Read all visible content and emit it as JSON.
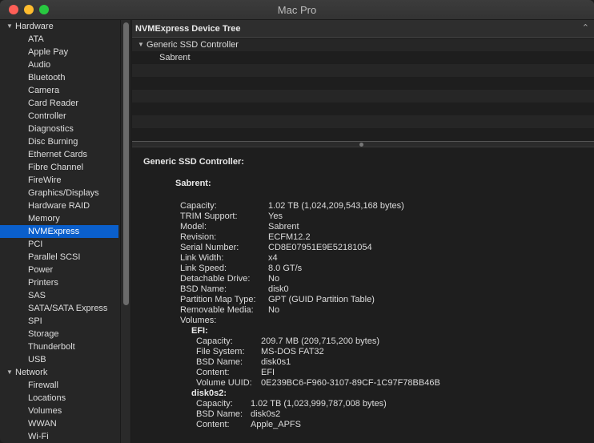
{
  "window": {
    "title": "Mac Pro"
  },
  "sidebar": {
    "items": [
      {
        "label": "Hardware",
        "group": true
      },
      {
        "label": "ATA"
      },
      {
        "label": "Apple Pay"
      },
      {
        "label": "Audio"
      },
      {
        "label": "Bluetooth"
      },
      {
        "label": "Camera"
      },
      {
        "label": "Card Reader"
      },
      {
        "label": "Controller"
      },
      {
        "label": "Diagnostics"
      },
      {
        "label": "Disc Burning"
      },
      {
        "label": "Ethernet Cards"
      },
      {
        "label": "Fibre Channel"
      },
      {
        "label": "FireWire"
      },
      {
        "label": "Graphics/Displays"
      },
      {
        "label": "Hardware RAID"
      },
      {
        "label": "Memory"
      },
      {
        "label": "NVMExpress",
        "selected": true
      },
      {
        "label": "PCI"
      },
      {
        "label": "Parallel SCSI"
      },
      {
        "label": "Power"
      },
      {
        "label": "Printers"
      },
      {
        "label": "SAS"
      },
      {
        "label": "SATA/SATA Express"
      },
      {
        "label": "SPI"
      },
      {
        "label": "Storage"
      },
      {
        "label": "Thunderbolt"
      },
      {
        "label": "USB"
      },
      {
        "label": "Network",
        "group": true
      },
      {
        "label": "Firewall"
      },
      {
        "label": "Locations"
      },
      {
        "label": "Volumes"
      },
      {
        "label": "WWAN"
      },
      {
        "label": "Wi-Fi"
      }
    ]
  },
  "tree": {
    "header": "NVMExpress Device Tree",
    "rows": [
      {
        "label": "Generic SSD Controller",
        "expanded": true
      },
      {
        "label": "Sabrent"
      }
    ]
  },
  "detail": {
    "controller_title": "Generic SSD Controller:",
    "device_title": "Sabrent:",
    "properties": [
      {
        "key": "Capacity:",
        "value": "1.02 TB (1,024,209,543,168 bytes)"
      },
      {
        "key": "TRIM Support:",
        "value": "Yes"
      },
      {
        "key": "Model:",
        "value": "Sabrent"
      },
      {
        "key": "Revision:",
        "value": "ECFM12.2"
      },
      {
        "key": "Serial Number:",
        "value": "CD8E07951E9E52181054"
      },
      {
        "key": "Link Width:",
        "value": "x4"
      },
      {
        "key": "Link Speed:",
        "value": "8.0 GT/s"
      },
      {
        "key": "Detachable Drive:",
        "value": "No"
      },
      {
        "key": "BSD Name:",
        "value": "disk0"
      },
      {
        "key": "Partition Map Type:",
        "value": "GPT (GUID Partition Table)"
      },
      {
        "key": "Removable Media:",
        "value": "No"
      }
    ],
    "volumes_label": "Volumes:",
    "volumes": [
      {
        "name": "EFI:",
        "properties": [
          {
            "key": "Capacity:",
            "value": "209.7 MB (209,715,200 bytes)"
          },
          {
            "key": "File System:",
            "value": "MS-DOS FAT32"
          },
          {
            "key": "BSD Name:",
            "value": "disk0s1"
          },
          {
            "key": "Content:",
            "value": "EFI"
          },
          {
            "key": "Volume UUID:",
            "value": "0E239BC6-F960-3107-89CF-1C97F78BB46B"
          }
        ]
      },
      {
        "name": "disk0s2:",
        "properties": [
          {
            "key": "Capacity:",
            "value": "1.02 TB (1,023,999,787,008 bytes)"
          },
          {
            "key": "BSD Name:",
            "value": "disk0s2"
          },
          {
            "key": "Content:",
            "value": "Apple_APFS"
          }
        ]
      }
    ]
  }
}
